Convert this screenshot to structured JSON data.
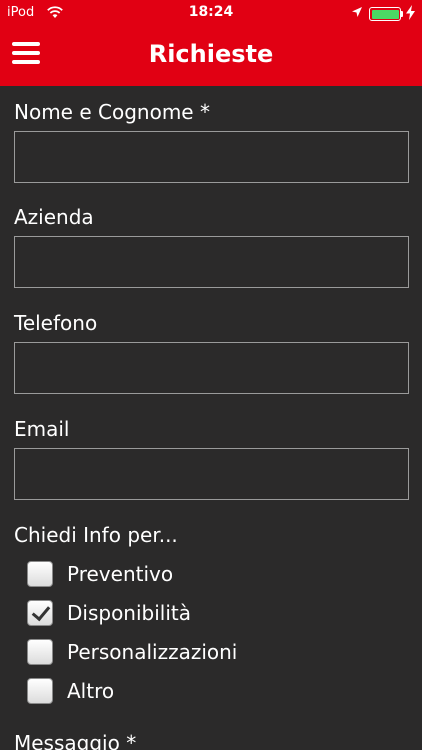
{
  "status_bar": {
    "carrier": "iPod",
    "time": "18:24",
    "battery_level": 1.0,
    "icons": [
      "wifi-icon",
      "location-arrow-icon",
      "battery-icon",
      "charging-bolt-icon"
    ]
  },
  "nav": {
    "title": "Richieste",
    "menu_icon": "hamburger-menu-icon"
  },
  "form": {
    "name_label": "Nome e Cognome *",
    "name_value": "",
    "company_label": "Azienda",
    "company_value": "",
    "phone_label": "Telefono",
    "phone_value": "",
    "email_label": "Email",
    "email_value": "",
    "info_label": "Chiedi Info per...",
    "options": [
      {
        "label": "Preventivo",
        "checked": false
      },
      {
        "label": "Disponibilità",
        "checked": true
      },
      {
        "label": "Personalizzazioni",
        "checked": false
      },
      {
        "label": "Altro",
        "checked": false
      }
    ],
    "message_label": "Messaggio *"
  },
  "colors": {
    "accent": "#e10013",
    "background": "#2b2a2a",
    "field_border": "#9a9a9a",
    "battery": "#4cd964"
  }
}
